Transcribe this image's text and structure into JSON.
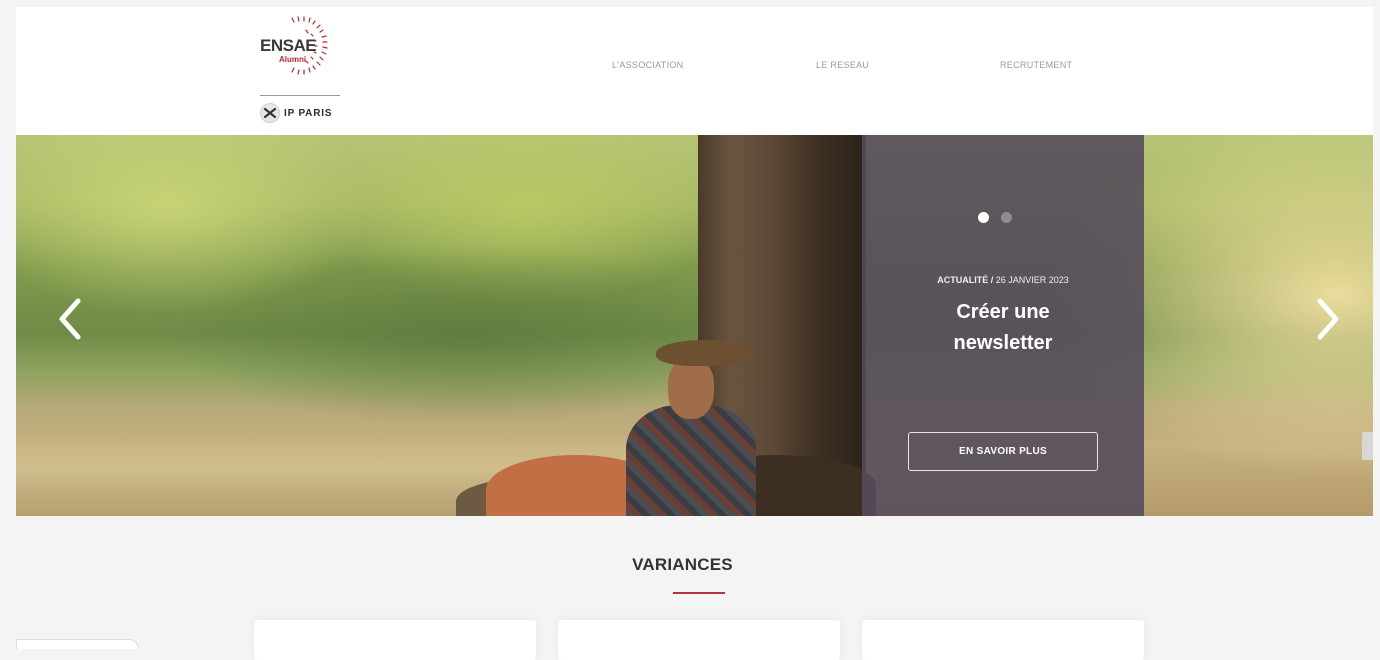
{
  "brand": {
    "name": "ENSAE",
    "sub": "Alumni",
    "partner": "IP PARIS"
  },
  "nav": {
    "items": [
      "L'ASSOCIATION",
      "LE RESEAU",
      "RECRUTEMENT"
    ]
  },
  "hero": {
    "slides_total": 2,
    "active_slide": 1,
    "category": "ACTUALITÉ /",
    "date": "26 JANVIER 2023",
    "title_line1": "Créer une",
    "title_line2": "newsletter",
    "cta_label": "EN SAVOIR PLUS",
    "prev_icon": "chevron-left-icon",
    "next_icon": "chevron-right-icon"
  },
  "section": {
    "title": "VARIANCES"
  },
  "colors": {
    "accent": "#b9333b",
    "overlay": "#554d5c",
    "nav_text": "#9a9a9a",
    "background": "#f4f4f4"
  }
}
